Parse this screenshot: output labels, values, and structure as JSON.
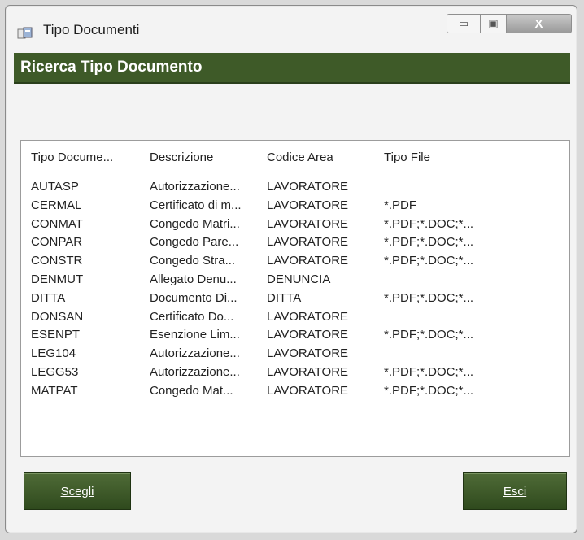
{
  "window": {
    "title": "Tipo Documenti",
    "controls": {
      "minimize": "▭",
      "maximize": "▣",
      "close": "X"
    }
  },
  "header": {
    "title": "Ricerca Tipo Documento"
  },
  "list": {
    "columns": [
      "Tipo Docume...",
      "Descrizione",
      "Codice Area",
      "Tipo File"
    ],
    "rows": [
      [
        "AUTASP",
        "Autorizzazione...",
        "LAVORATORE",
        ""
      ],
      [
        "CERMAL",
        "Certificato di m...",
        "LAVORATORE",
        "*.PDF"
      ],
      [
        "CONMAT",
        "Congedo Matri...",
        "LAVORATORE",
        "*.PDF;*.DOC;*..."
      ],
      [
        "CONPAR",
        "Congedo Pare...",
        "LAVORATORE",
        "*.PDF;*.DOC;*..."
      ],
      [
        "CONSTR",
        "Congedo Stra...",
        "LAVORATORE",
        "*.PDF;*.DOC;*..."
      ],
      [
        "DENMUT",
        "Allegato Denu...",
        "DENUNCIA",
        ""
      ],
      [
        "DITTA",
        "Documento Di...",
        "DITTA",
        "*.PDF;*.DOC;*..."
      ],
      [
        "DONSAN",
        "Certificato Do...",
        "LAVORATORE",
        ""
      ],
      [
        "ESENPT",
        "Esenzione Lim...",
        "LAVORATORE",
        "*.PDF;*.DOC;*..."
      ],
      [
        "LEG104",
        "Autorizzazione...",
        "LAVORATORE",
        ""
      ],
      [
        "LEGG53",
        "Autorizzazione...",
        "LAVORATORE",
        "*.PDF;*.DOC;*..."
      ],
      [
        "MATPAT",
        "Congedo Mat...",
        "LAVORATORE",
        "*.PDF;*.DOC;*..."
      ]
    ]
  },
  "buttons": {
    "choose": "Scegli",
    "exit": "Esci"
  },
  "colors": {
    "accent": "#3e5a28"
  }
}
